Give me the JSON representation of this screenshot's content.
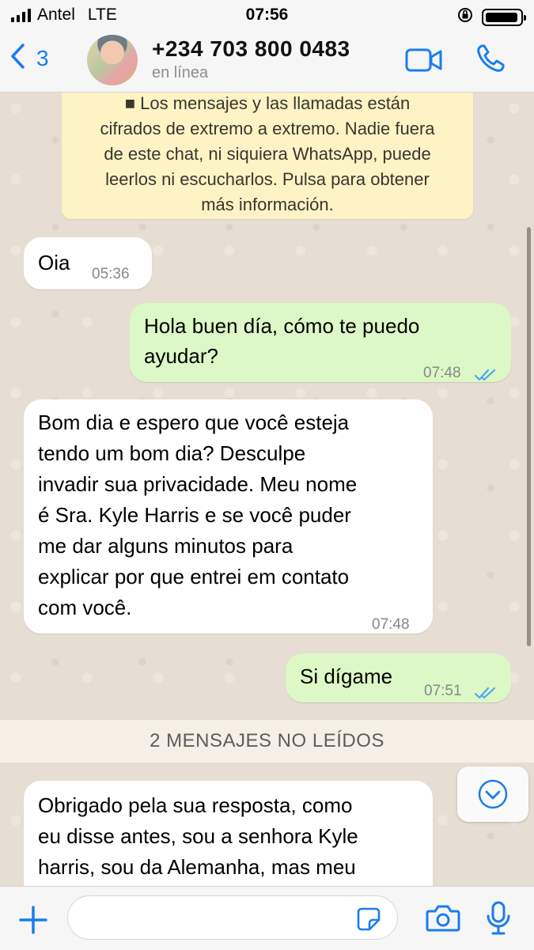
{
  "status_bar": {
    "carrier": "Antel",
    "network": "LTE",
    "time": "07:56",
    "battery_level": 1.0,
    "icons": [
      "signal-icon",
      "orientation-lock-icon",
      "battery-icon"
    ]
  },
  "header": {
    "back_count": "3",
    "contact_name": "+234 703 800 0483",
    "contact_status": "en línea",
    "icons": [
      "back-chevron-icon",
      "video-call-icon",
      "phone-call-icon"
    ]
  },
  "chat": {
    "encryption_notice": {
      "line1": "■ Los mensajes y las llamadas están",
      "line2": "cifrados de extremo a extremo. Nadie fuera",
      "line3": "de este chat, ni siquiera WhatsApp, puede",
      "line4": "leerlos ni escucharlos. Pulsa para obtener",
      "line5": "más información."
    },
    "messages": [
      {
        "direction": "in",
        "lines": [
          "Oia"
        ],
        "time": "05:36"
      },
      {
        "direction": "out",
        "lines": [
          "Hola buen día, cómo te puedo",
          "ayudar?"
        ],
        "time": "07:48",
        "read": true
      },
      {
        "direction": "in",
        "lines": [
          "Bom dia e espero que você esteja",
          "tendo um bom dia?  Desculpe",
          "invadir sua privacidade.  Meu nome",
          "é Sra. Kyle Harris e se você puder",
          "me dar alguns minutos para",
          "explicar por que entrei em contato",
          "com você."
        ],
        "time": "07:48"
      },
      {
        "direction": "out",
        "lines": [
          "Si dígame"
        ],
        "time": "07:51",
        "read": true
      },
      {
        "direction": "in",
        "lines": [
          "Obrigado pela sua resposta, como",
          "eu disse antes, sou a senhora Kyle",
          "harris, sou da Alemanha, mas meu"
        ]
      }
    ],
    "unread_divider": "2 MENSAJES NO LEÍDOS",
    "colors": {
      "incoming": "#ffffff",
      "outgoing": "#dcf8c6",
      "read_ticks": "#4fa6f0",
      "accent": "#1a7cf0"
    }
  },
  "composer": {
    "placeholder": "",
    "icons": [
      "plus-icon",
      "sticker-icon",
      "camera-icon",
      "microphone-icon"
    ]
  }
}
